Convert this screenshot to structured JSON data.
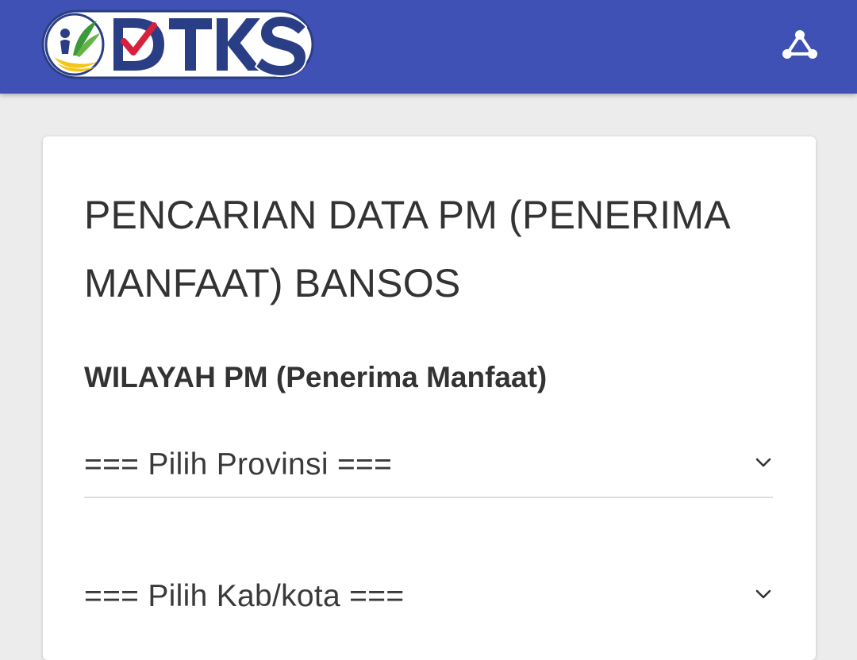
{
  "header": {
    "logo_text": "DTKS",
    "share_icon": "share-icon",
    "background": "#3f51b5"
  },
  "card": {
    "title": "PENCARIAN DATA PM (PENERIMA MANFAAT) BANSOS",
    "section_label": "WILAYAH PM (Penerima Manfaat)",
    "province_select": {
      "selected": "=== Pilih Provinsi ===",
      "icon": "chevron-down-icon"
    },
    "city_select": {
      "selected": "=== Pilih Kab/kota ===",
      "icon": "chevron-down-icon"
    }
  }
}
